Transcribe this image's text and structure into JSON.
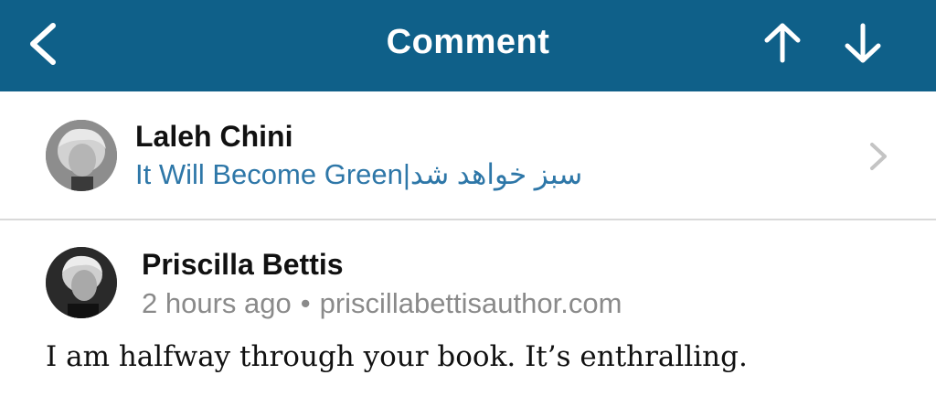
{
  "header": {
    "title": "Comment",
    "back_icon": "chevron-left-icon",
    "prev_icon": "arrow-up-icon",
    "next_icon": "arrow-down-icon",
    "background_color": "#0f6089"
  },
  "post": {
    "author": "Laleh Chini",
    "title": "It Will Become Green|سبز خواهد شد",
    "title_color": "#2e77a8",
    "chevron_icon": "chevron-right-icon"
  },
  "comment": {
    "author": "Priscilla Bettis",
    "time": "2 hours ago",
    "separator": "•",
    "website": "priscillabettisauthor.com",
    "text": "I am halfway through your book. It’s enthralling."
  }
}
